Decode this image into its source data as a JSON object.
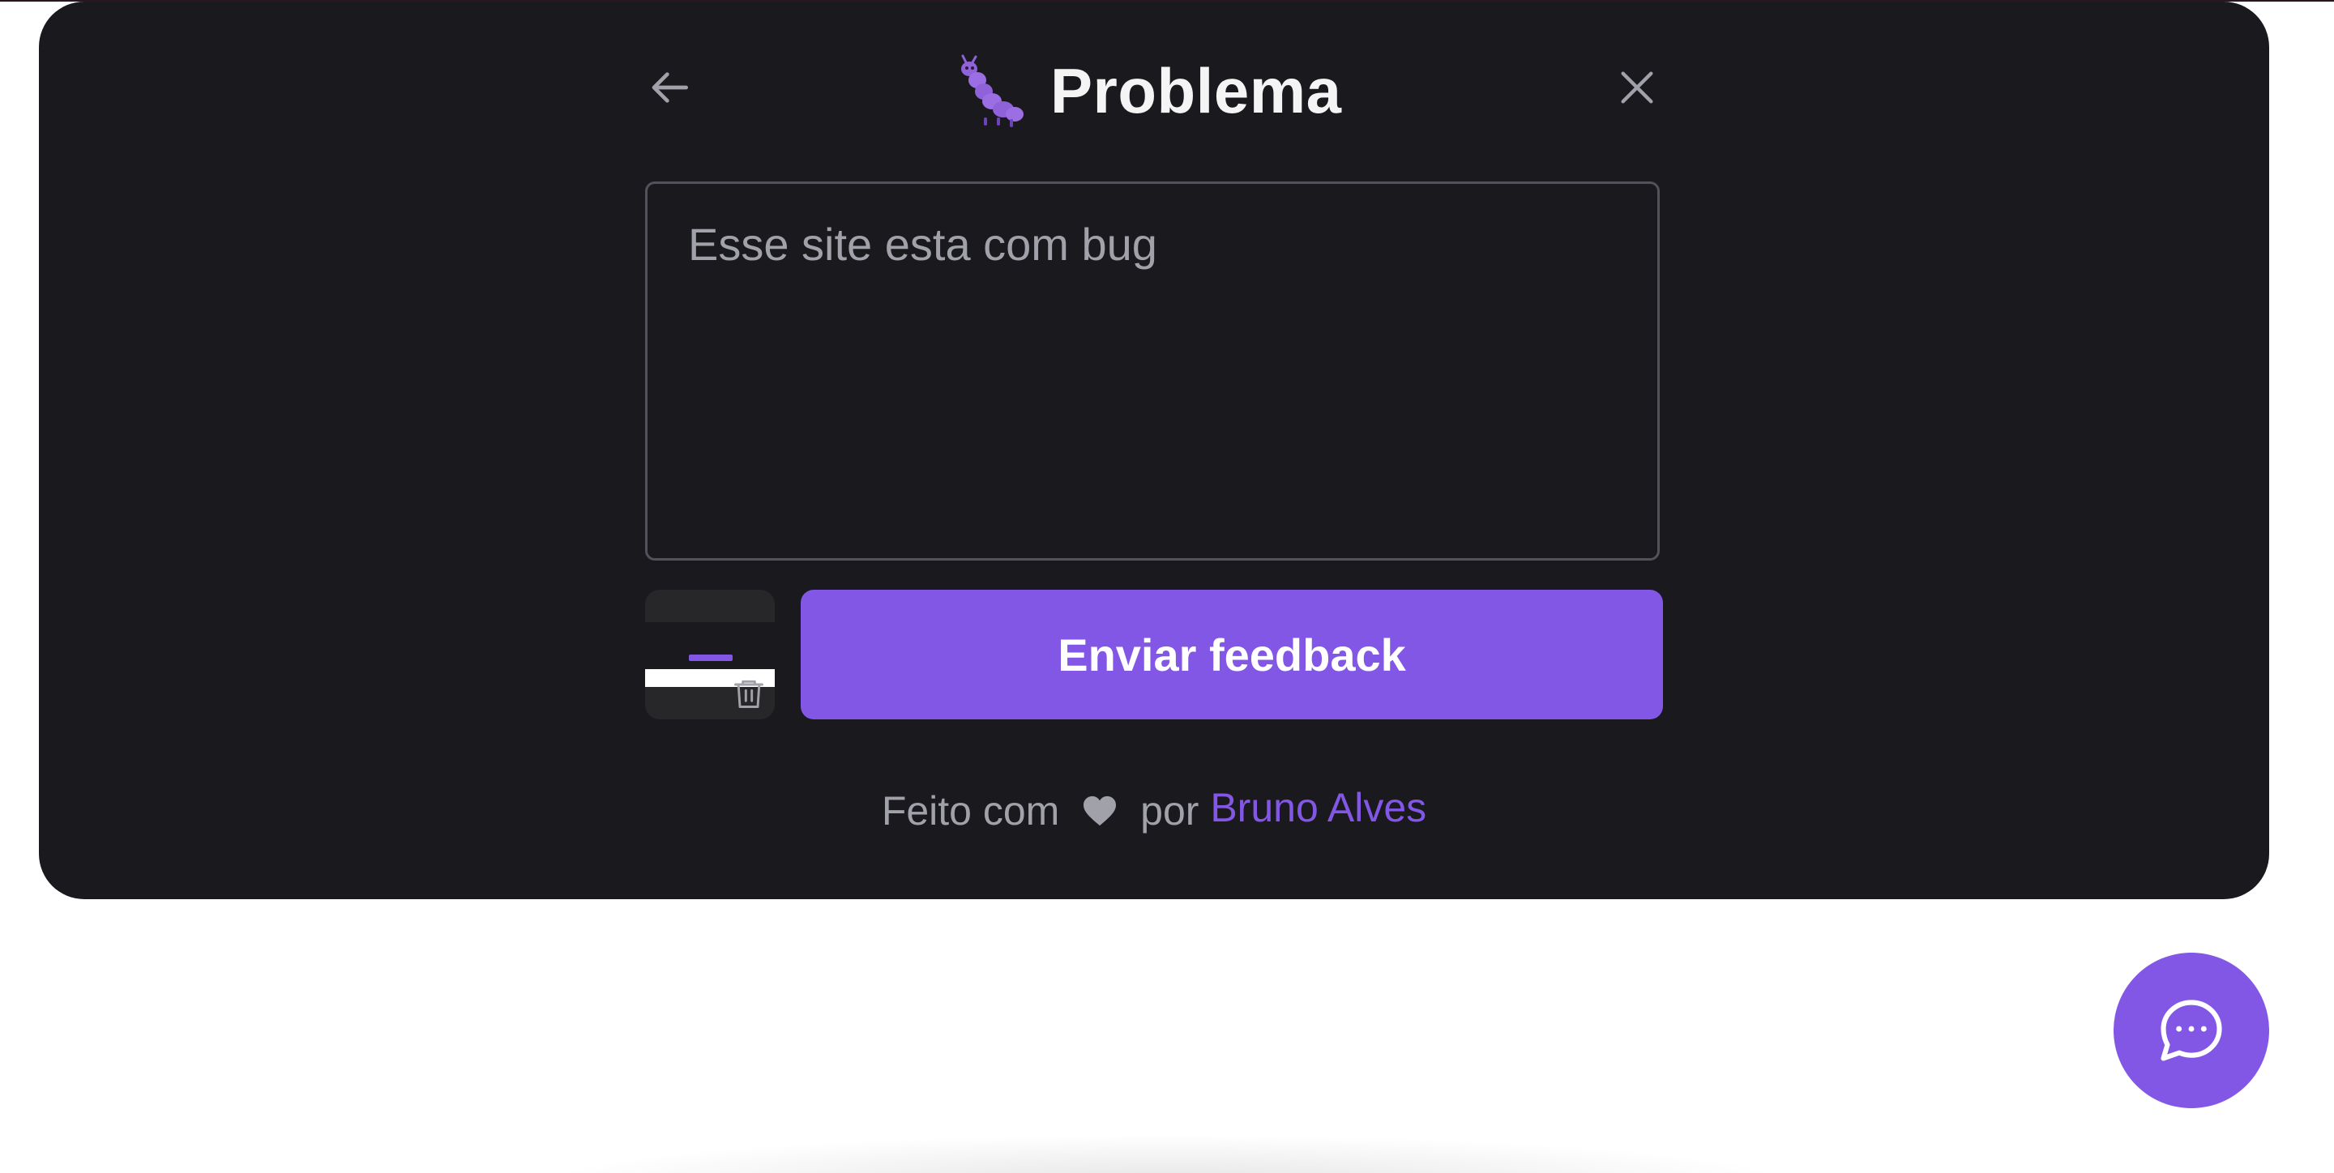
{
  "header": {
    "title": "Problema",
    "title_icon": "bug-caterpillar-icon",
    "back_icon": "arrow-left-icon",
    "close_icon": "close-icon"
  },
  "form": {
    "comment_placeholder": "Esse site esta com bug",
    "comment_value": "",
    "screenshot_label": "screenshot-preview",
    "delete_icon": "trash-icon",
    "submit_label": "Enviar feedback"
  },
  "footer": {
    "prefix": "Feito com",
    "heart_icon": "heart-icon",
    "middle": "por",
    "author": "Bruno Alves"
  },
  "floating": {
    "icon": "chat-dots-icon"
  },
  "colors": {
    "brand": "#8257e5",
    "card_bg": "#1a191e",
    "text_primary": "#f4f4f5",
    "text_secondary": "#a1a1aa",
    "border": "#52525b",
    "page_bg": "#ffffff"
  }
}
